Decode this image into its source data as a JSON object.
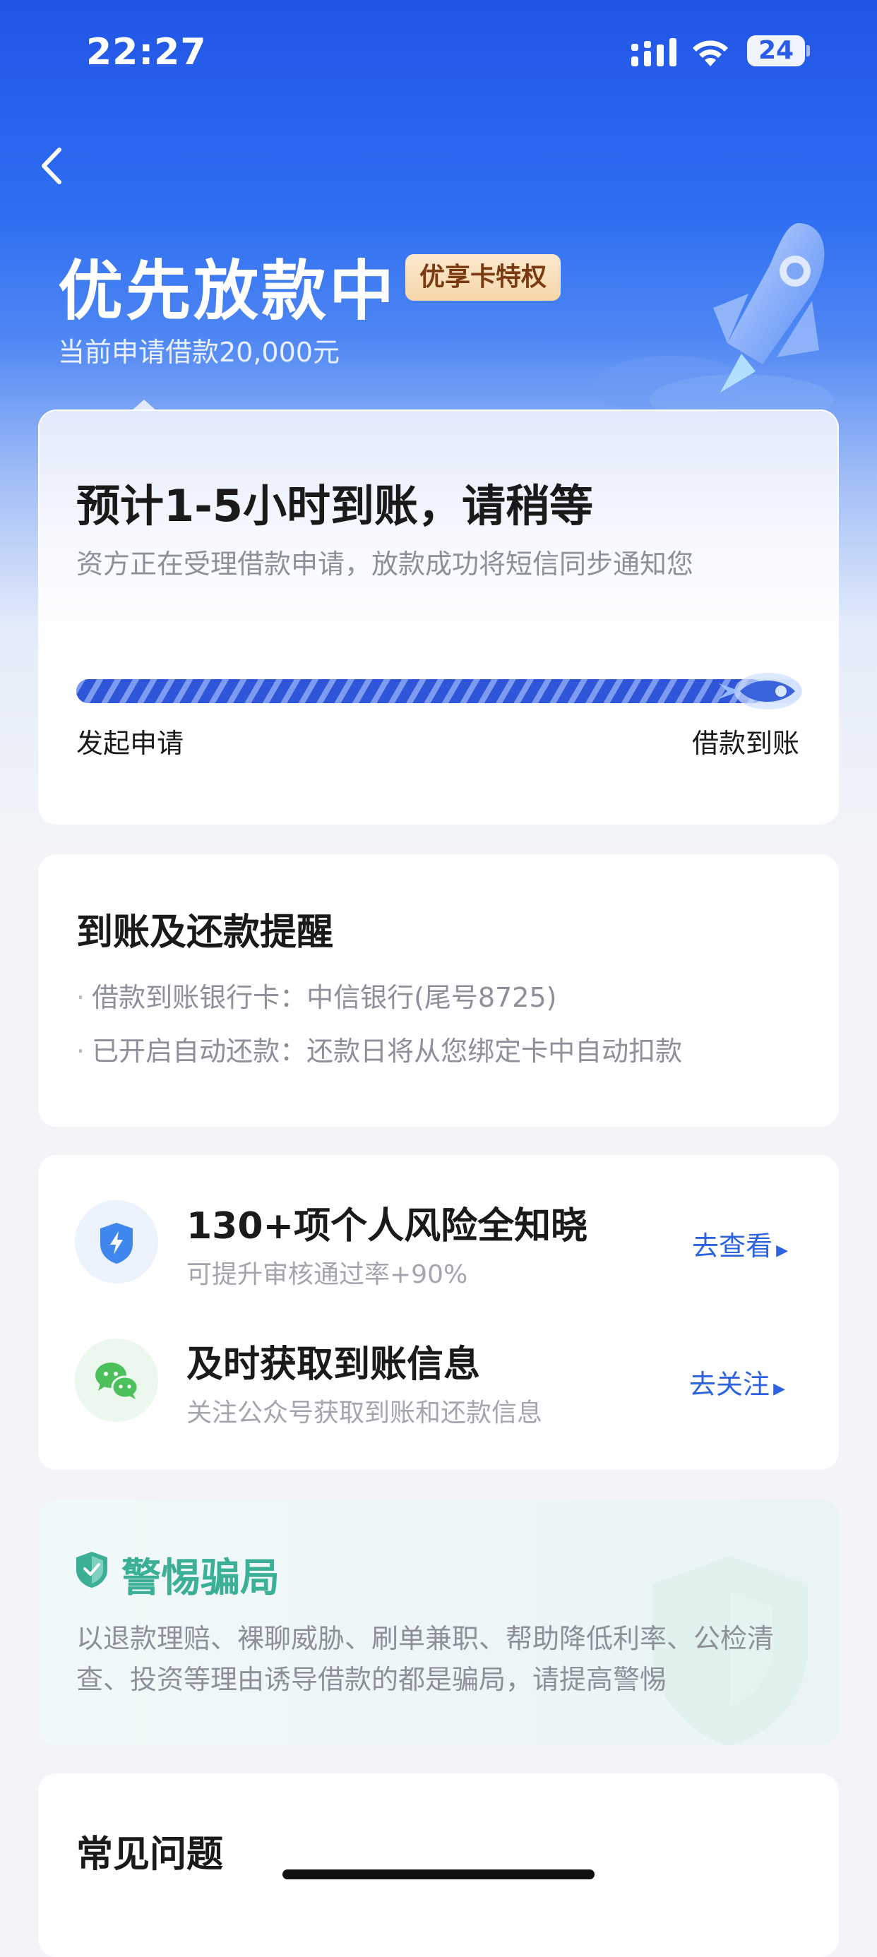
{
  "status_bar": {
    "time": "22:27",
    "battery": "24"
  },
  "header": {
    "title": "优先放款中",
    "badge": "优享卡特权",
    "subtitle": "当前申请借款20,000元"
  },
  "status_card": {
    "eta": "预计1-5小时到账，请稍等",
    "description": "资方正在受理借款申请，放款成功将短信同步通知您",
    "progress_start_label": "发起申请",
    "progress_end_label": "借款到账",
    "progress_fraction": 0.95
  },
  "reminder": {
    "title": "到账及还款提醒",
    "items": [
      "借款到账银行卡：中信银行(尾号8725)",
      "已开启自动还款：还款日将从您绑定卡中自动扣款"
    ]
  },
  "actions": [
    {
      "icon": "shield-lightning-icon",
      "title": "130+项个人风险全知晓",
      "subtitle": "可提升审核通过率+90%",
      "link": "去查看"
    },
    {
      "icon": "wechat-icon",
      "title": "及时获取到账信息",
      "subtitle": "关注公众号获取到账和还款信息",
      "link": "去关注"
    }
  ],
  "warning": {
    "title": "警惕骗局",
    "body": "以退款理赔、裸聊威胁、刷单兼职、帮助降低利率、公检清查、投资等理由诱导借款的都是骗局，请提高警惕"
  },
  "faq": {
    "title": "常见问题"
  },
  "colors": {
    "primary": "#2f6ff2",
    "link": "#2d63e0",
    "warning_green": "#3bb096",
    "badge_text": "#7a3a12"
  }
}
